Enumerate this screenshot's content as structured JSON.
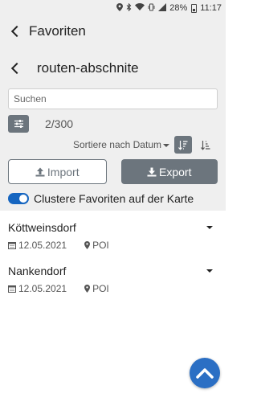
{
  "status_bar": {
    "battery": "28%",
    "time": "11:17"
  },
  "header": {
    "title": "Favoriten"
  },
  "sub_header": {
    "title": "routen-abschnite"
  },
  "search": {
    "placeholder": "Suchen",
    "value": ""
  },
  "filter": {
    "count": "2/300"
  },
  "sort": {
    "label": "Sortiere nach Datum"
  },
  "actions": {
    "import_label": "Import",
    "export_label": "Export"
  },
  "cluster_toggle": {
    "label": "Clustere Favoriten auf der Karte",
    "on": true
  },
  "items": [
    {
      "name": "Köttweinsdorf",
      "date": "12.05.2021",
      "type": "POI"
    },
    {
      "name": "Nankendorf",
      "date": "12.05.2021",
      "type": "POI"
    }
  ],
  "colors": {
    "accent": "#1565c0",
    "button": "#6c757d",
    "fab": "#2b6fc4",
    "panel": "#efefef"
  }
}
